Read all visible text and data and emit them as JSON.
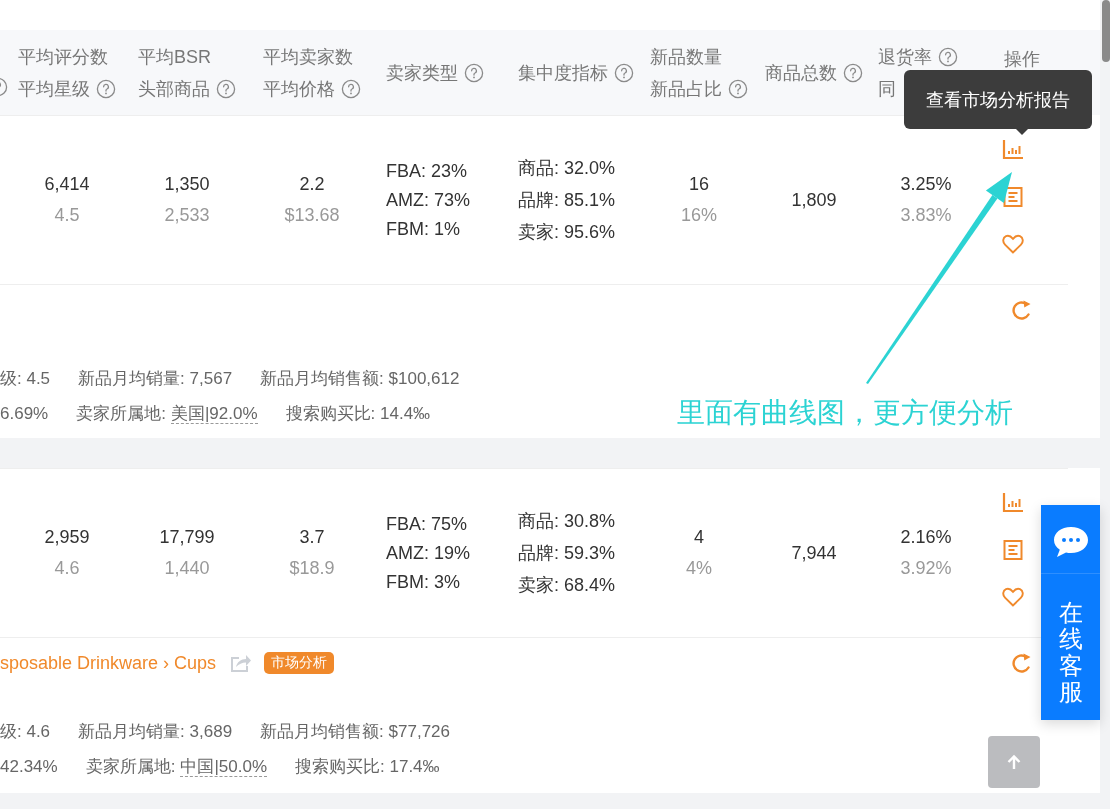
{
  "header": {
    "leading_help": true,
    "columns": [
      {
        "lines": [
          {
            "text": "平均评分数",
            "help": false
          },
          {
            "text": "平均星级",
            "help": true
          }
        ]
      },
      {
        "lines": [
          {
            "text": "平均BSR",
            "help": false
          },
          {
            "text": "头部商品",
            "help": true
          }
        ]
      },
      {
        "lines": [
          {
            "text": "平均卖家数",
            "help": false
          },
          {
            "text": "平均价格",
            "help": true
          }
        ]
      },
      {
        "lines": [
          {
            "text": "卖家类型",
            "help": true
          }
        ]
      },
      {
        "lines": [
          {
            "text": "集中度指标",
            "help": true
          }
        ]
      },
      {
        "lines": [
          {
            "text": "新品数量",
            "help": false
          },
          {
            "text": "新品占比",
            "help": true
          }
        ]
      },
      {
        "lines": [
          {
            "text": "商品总数",
            "help": true
          }
        ]
      },
      {
        "lines": [
          {
            "text": "退货率",
            "help": true
          },
          {
            "text": "同",
            "help": false
          }
        ]
      },
      {
        "lines": [
          {
            "text": "操作",
            "help": false
          }
        ]
      }
    ]
  },
  "tooltip": {
    "text": "查看市场分析报告"
  },
  "rows": [
    {
      "cells": [
        {
          "kind": "pair",
          "main": "6,414",
          "sub": "4.5"
        },
        {
          "kind": "pair",
          "main": "1,350",
          "sub": "2,533"
        },
        {
          "kind": "pair",
          "main": "2.2",
          "sub": "$13.68"
        },
        {
          "kind": "list",
          "lines": [
            "FBA: 23%",
            "AMZ: 73%",
            "FBM: 1%"
          ]
        },
        {
          "kind": "list",
          "lines": [
            "商品: 32.0%",
            "品牌: 85.1%",
            "卖家: 95.6%"
          ]
        },
        {
          "kind": "pair",
          "main": "16",
          "sub": "16%"
        },
        {
          "kind": "single",
          "main": "1,809"
        },
        {
          "kind": "pair",
          "main": "3.25%",
          "sub": "3.83%"
        },
        {
          "kind": "actions"
        }
      ],
      "detail": {
        "lines": [
          [
            {
              "text": "级: 4.5"
            },
            {
              "text": "新品月均销量: 7,567"
            },
            {
              "text": "新品月均销售额: $100,612"
            }
          ],
          [
            {
              "text": "6.69%"
            },
            {
              "text": "卖家所属地:",
              "link": "美国|92.0%"
            },
            {
              "text": "搜索购买比: 14.4‰"
            }
          ]
        ]
      }
    },
    {
      "cells": [
        {
          "kind": "pair",
          "main": "2,959",
          "sub": "4.6"
        },
        {
          "kind": "pair",
          "main": "17,799",
          "sub": "1,440"
        },
        {
          "kind": "pair",
          "main": "3.7",
          "sub": "$18.9"
        },
        {
          "kind": "list",
          "lines": [
            "FBA: 75%",
            "AMZ: 19%",
            "FBM: 3%"
          ]
        },
        {
          "kind": "list",
          "lines": [
            "商品: 30.8%",
            "品牌: 59.3%",
            "卖家: 68.4%"
          ]
        },
        {
          "kind": "pair",
          "main": "4",
          "sub": "4%"
        },
        {
          "kind": "single",
          "main": "7,944"
        },
        {
          "kind": "pair",
          "main": "2.16%",
          "sub": "3.92%"
        },
        {
          "kind": "actions"
        }
      ],
      "detail": {
        "breadcrumb": {
          "text": "sposable Drinkware › Cups",
          "badge": "市场分析"
        },
        "lines": [
          [
            {
              "text": "级: 4.6"
            },
            {
              "text": "新品月均销量: 3,689"
            },
            {
              "text": "新品月均销售额: $77,726"
            }
          ],
          [
            {
              "text": "42.34%"
            },
            {
              "text": "卖家所属地:",
              "link": "中国|50.0%"
            },
            {
              "text": "搜索购买比: 17.4‰"
            }
          ]
        ]
      }
    }
  ],
  "callout": {
    "text": "里面有曲线图，更方便分析"
  },
  "service": {
    "label": "在线客服"
  }
}
